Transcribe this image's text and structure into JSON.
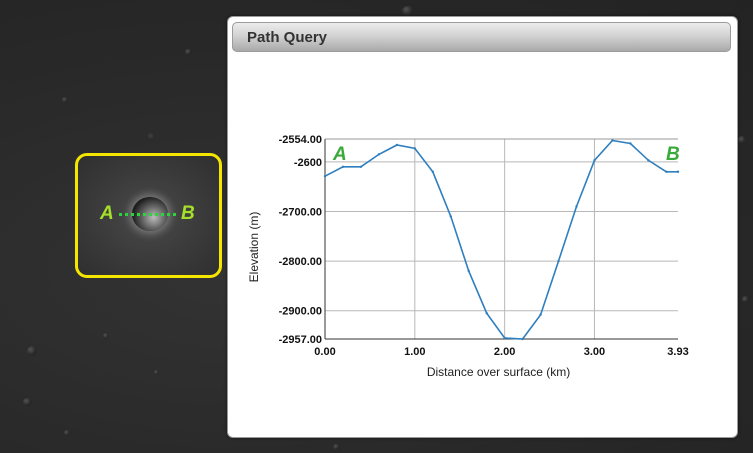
{
  "dialog": {
    "title": "Path Query"
  },
  "map": {
    "start_label": "A",
    "end_label": "B",
    "highlight_color": "#f5e600",
    "path_color": "#2bd43b"
  },
  "chart_data": {
    "type": "line",
    "title": "",
    "xlabel": "Distance over surface (km)",
    "ylabel": "Elevation (m)",
    "xlim": [
      0,
      3.93
    ],
    "ylim": [
      -2957,
      -2554
    ],
    "x_ticks": [
      "0.00",
      "1.00",
      "2.00",
      "3.00",
      "3.93"
    ],
    "y_ticks": [
      "-2554.00",
      "-2600",
      "-2700.00",
      "-2800.00",
      "-2900.00",
      "-2957.00"
    ],
    "start_marker": "A",
    "end_marker": "B",
    "line_color": "#2f7fbf",
    "grid": true,
    "series": [
      {
        "x": [
          0,
          0.2,
          0.4,
          0.6,
          0.8,
          1.0,
          1.2,
          1.4,
          1.6,
          1.8,
          2.0,
          2.2,
          2.4,
          2.6,
          2.8,
          3.0,
          3.2,
          3.4,
          3.6,
          3.8,
          3.93
        ],
        "y": [
          -2629,
          -2610,
          -2610,
          -2585,
          -2566,
          -2573,
          -2620,
          -2710,
          -2820,
          -2905,
          -2955,
          -2957,
          -2908,
          -2800,
          -2690,
          -2597,
          -2557,
          -2563,
          -2597,
          -2620,
          -2620
        ]
      }
    ]
  }
}
